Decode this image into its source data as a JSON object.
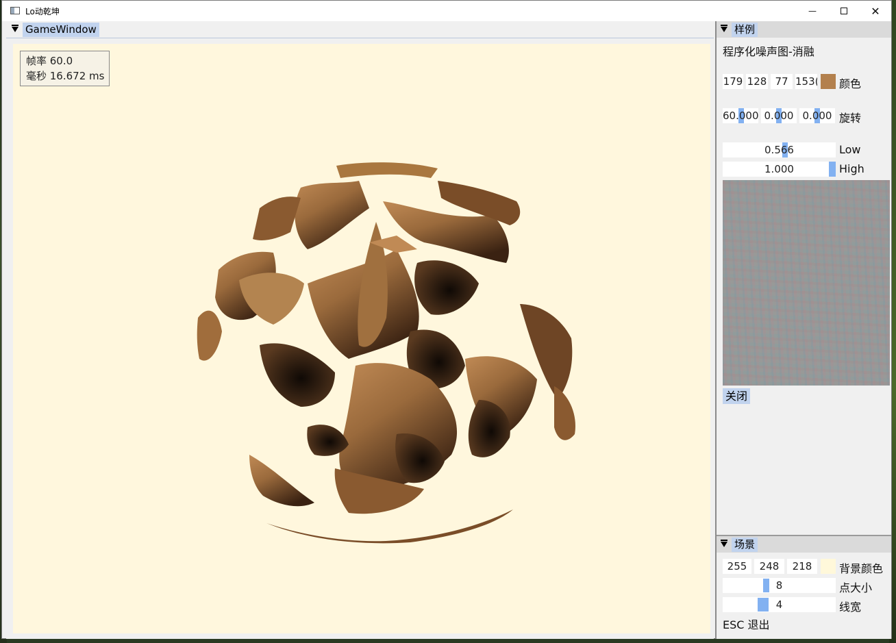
{
  "window": {
    "title": "Lo动乾坤",
    "minimize": "—",
    "close": "✕"
  },
  "game_window": {
    "tab_label": "GameWindow",
    "fps_line": "帧率 60.0",
    "ms_line": "毫秒 16.672 ms",
    "background_color": "#fff7dd",
    "sphere_colors": {
      "light": "#b07a48",
      "dark": "#1a0f08"
    }
  },
  "sample_panel": {
    "tab_label": "样例",
    "subtitle": "程序化噪声图-消融",
    "color": {
      "r": "179",
      "g": "128",
      "b": "77",
      "a": "153(",
      "swatch": "#b3804d",
      "label": "颜色"
    },
    "rotation": {
      "x": "60.000",
      "y": "0.000",
      "z": "0.000",
      "label": "旋转",
      "thumb_levels": [
        0.5,
        0.5,
        0.5
      ]
    },
    "low": {
      "value": "0.566",
      "label": "Low",
      "level": 0.566
    },
    "high": {
      "value": "1.000",
      "label": "High",
      "level": 1.0
    },
    "close_button": "关闭"
  },
  "scene_panel": {
    "tab_label": "场景",
    "bg_color": {
      "r": "255",
      "g": "248",
      "b": "218",
      "swatch": "#fff8da",
      "label": "背景颜色"
    },
    "point_size": {
      "value": "8",
      "label": "点大小",
      "level": 0.38
    },
    "line_width": {
      "value": "4",
      "label": "线宽",
      "level": 0.34
    },
    "esc_hint": "ESC 退出"
  }
}
